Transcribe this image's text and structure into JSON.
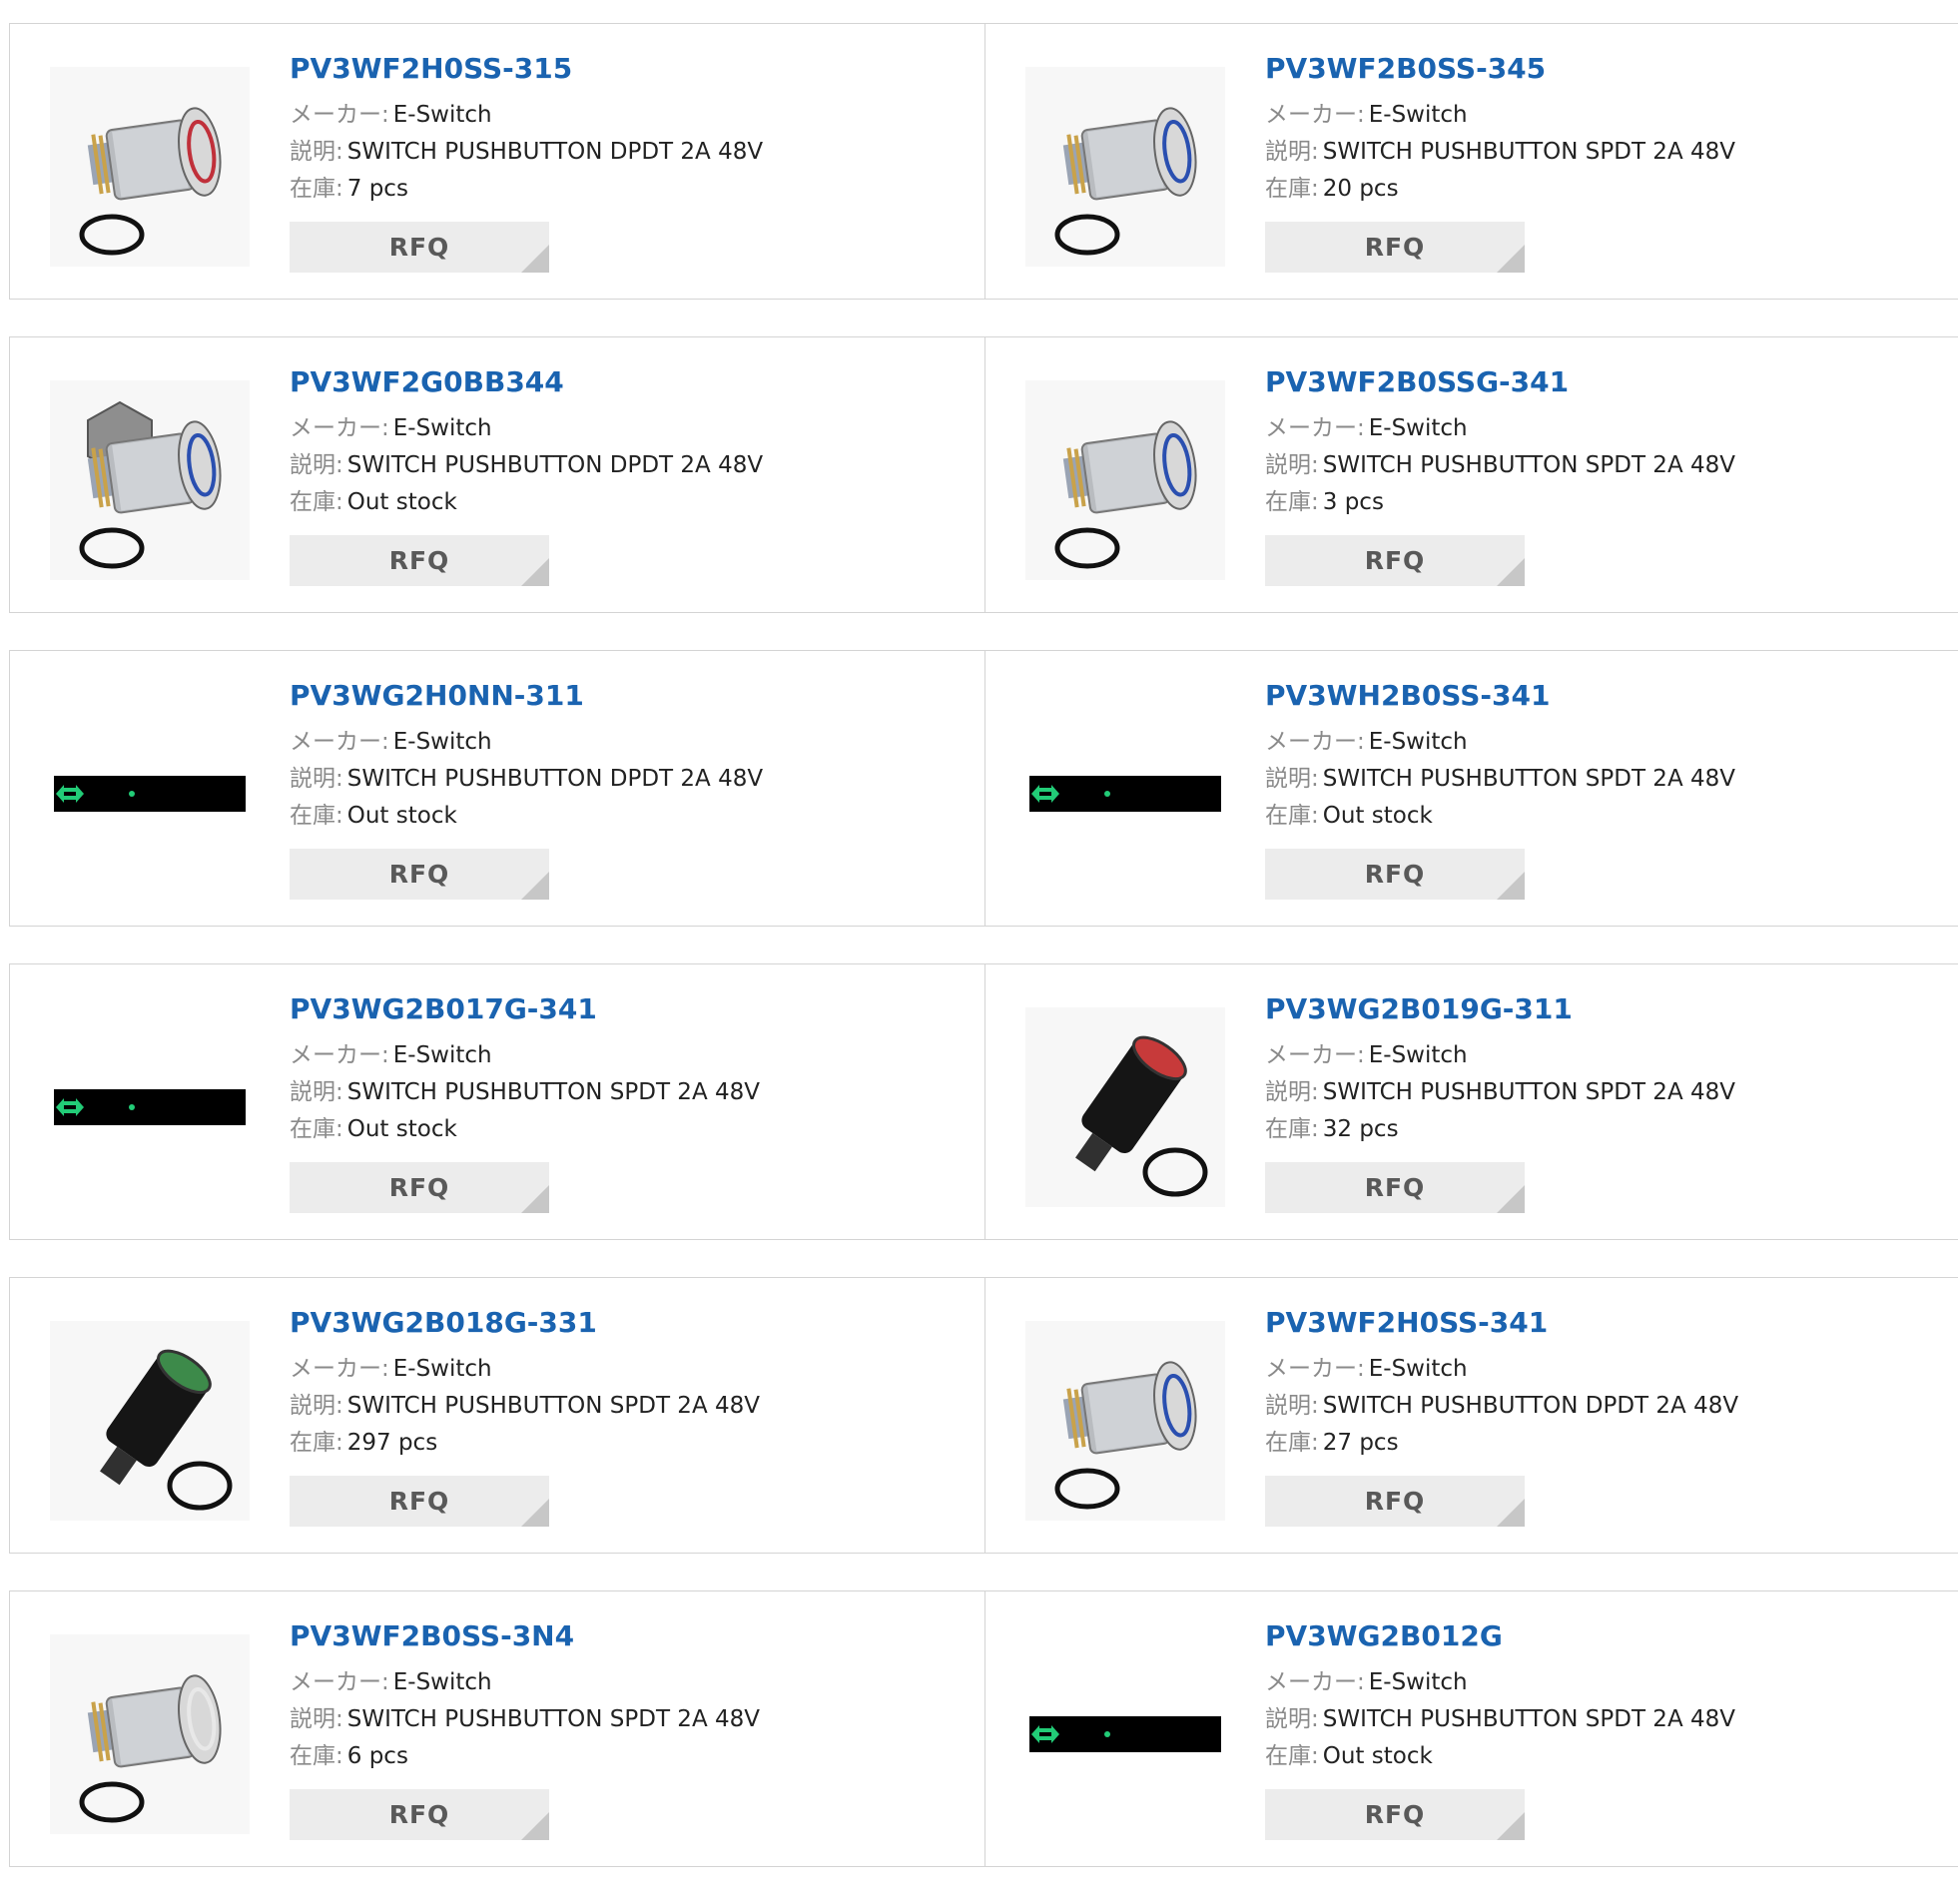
{
  "labels": {
    "maker": "メーカー:",
    "description": "説明:",
    "stock": "在庫:",
    "rfq": "RFQ"
  },
  "colors": {
    "part_link": "#1a63b0",
    "rfq_bg": "#ececec",
    "border": "#d4d4d4"
  },
  "products": [
    {
      "part": "PV3WF2H0SS-315",
      "maker": "E-Switch",
      "description": "SWITCH PUSHBUTTON DPDT 2A 48V",
      "stock": "7 pcs",
      "image": "steel-switch-red-ring"
    },
    {
      "part": "PV3WF2B0SS-345",
      "maker": "E-Switch",
      "description": "SWITCH PUSHBUTTON SPDT 2A 48V",
      "stock": "20 pcs",
      "image": "steel-switch-blue-ring"
    },
    {
      "part": "PV3WF2G0BB344",
      "maker": "E-Switch",
      "description": "SWITCH PUSHBUTTON DPDT 2A 48V",
      "stock": "Out stock",
      "image": "steel-switch-hex-blue-ring"
    },
    {
      "part": "PV3WF2B0SSG-341",
      "maker": "E-Switch",
      "description": "SWITCH PUSHBUTTON SPDT 2A 48V",
      "stock": "3 pcs",
      "image": "steel-switch-blue-ring"
    },
    {
      "part": "PV3WG2H0NN-311",
      "maker": "E-Switch",
      "description": "SWITCH PUSHBUTTON DPDT 2A 48V",
      "stock": "Out stock",
      "image": "no-image-placeholder"
    },
    {
      "part": "PV3WH2B0SS-341",
      "maker": "E-Switch",
      "description": "SWITCH PUSHBUTTON SPDT 2A 48V",
      "stock": "Out stock",
      "image": "no-image-placeholder"
    },
    {
      "part": "PV3WG2B017G-341",
      "maker": "E-Switch",
      "description": "SWITCH PUSHBUTTON SPDT 2A 48V",
      "stock": "Out stock",
      "image": "no-image-placeholder"
    },
    {
      "part": "PV3WG2B019G-311",
      "maker": "E-Switch",
      "description": "SWITCH PUSHBUTTON SPDT 2A 48V",
      "stock": "32 pcs",
      "image": "black-switch-red-cap"
    },
    {
      "part": "PV3WG2B018G-331",
      "maker": "E-Switch",
      "description": "SWITCH PUSHBUTTON SPDT 2A 48V",
      "stock": "297 pcs",
      "image": "black-switch-green-cap"
    },
    {
      "part": "PV3WF2H0SS-341",
      "maker": "E-Switch",
      "description": "SWITCH PUSHBUTTON DPDT 2A 48V",
      "stock": "27 pcs",
      "image": "steel-switch-blue-ring"
    },
    {
      "part": "PV3WF2B0SS-3N4",
      "maker": "E-Switch",
      "description": "SWITCH PUSHBUTTON SPDT 2A 48V",
      "stock": "6 pcs",
      "image": "steel-switch-white-ring"
    },
    {
      "part": "PV3WG2B012G",
      "maker": "E-Switch",
      "description": "SWITCH PUSHBUTTON SPDT 2A 48V",
      "stock": "Out stock",
      "image": "no-image-placeholder"
    }
  ]
}
